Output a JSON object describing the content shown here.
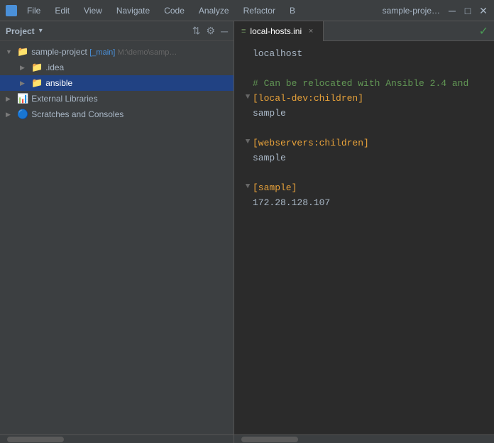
{
  "titlebar": {
    "app_icon": "jetbrains-icon",
    "menus": [
      "File",
      "Edit",
      "View",
      "Navigate",
      "Code",
      "Analyze",
      "Refactor",
      "B"
    ],
    "project_title": "sample-proje…",
    "controls": [
      "─",
      "□",
      "✕"
    ]
  },
  "sidebar": {
    "title": "Project",
    "tree": [
      {
        "id": "sample-project",
        "label": "sample-project",
        "branch": "[_main]",
        "path": "M:\\demo\\samp…",
        "indent": 0,
        "expanded": true,
        "type": "project"
      },
      {
        "id": "idea",
        "label": ".idea",
        "indent": 1,
        "expanded": false,
        "type": "folder-blue"
      },
      {
        "id": "ansible",
        "label": "ansible",
        "indent": 1,
        "expanded": true,
        "type": "folder-orange",
        "selected": true
      },
      {
        "id": "external-libraries",
        "label": "External Libraries",
        "indent": 0,
        "type": "special"
      },
      {
        "id": "scratches",
        "label": "Scratches and Consoles",
        "indent": 0,
        "type": "special2"
      }
    ]
  },
  "editor": {
    "tab": {
      "icon": "ini-icon",
      "label": "local-hosts.ini",
      "close_label": "×"
    },
    "status_check": "✓",
    "code_lines": [
      {
        "gutter": "",
        "fold": "",
        "content": "localhost",
        "type": "host"
      },
      {
        "gutter": "",
        "fold": "",
        "content": "",
        "type": "empty"
      },
      {
        "gutter": "",
        "fold": "",
        "content": "# Can be relocated with Ansible 2.4 and",
        "type": "comment"
      },
      {
        "gutter": "",
        "fold": "▼",
        "content": "[local-dev:children]",
        "type": "section"
      },
      {
        "gutter": "",
        "fold": "",
        "content": "sample",
        "type": "host"
      },
      {
        "gutter": "",
        "fold": "",
        "content": "",
        "type": "empty"
      },
      {
        "gutter": "",
        "fold": "▼",
        "content": "[webservers:children]",
        "type": "section"
      },
      {
        "gutter": "",
        "fold": "",
        "content": "sample",
        "type": "host"
      },
      {
        "gutter": "",
        "fold": "",
        "content": "",
        "type": "empty"
      },
      {
        "gutter": "",
        "fold": "▼",
        "content": "[sample]",
        "type": "section"
      },
      {
        "gutter": "",
        "fold": "",
        "content": "172.28.128.107",
        "type": "host"
      }
    ]
  },
  "colors": {
    "accent_blue": "#4a90d9",
    "selected_bg": "#214283",
    "comment_green": "#629755",
    "section_orange": "#e8a23a",
    "check_green": "#499c54"
  }
}
